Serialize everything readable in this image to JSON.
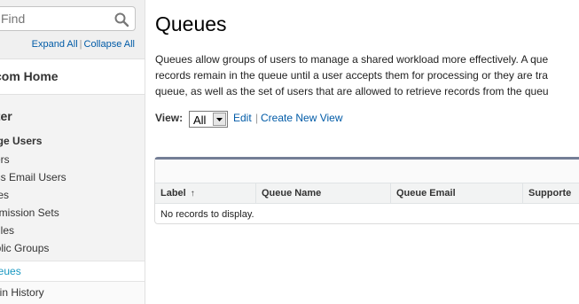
{
  "sidebar": {
    "search_placeholder": "Find",
    "expand_all": "Expand All",
    "separator": "|",
    "collapse_all": "Collapse All",
    "home_link": "com Home",
    "section_title": "ster",
    "group_title": "age Users",
    "items": [
      {
        "label": "sers"
      },
      {
        "label": "ass Email Users"
      },
      {
        "label": "bles"
      },
      {
        "label": "ermission Sets"
      },
      {
        "label": "ofiles"
      },
      {
        "label": "ublic Groups"
      }
    ],
    "selected_item": "ueues",
    "next_item": "gin History"
  },
  "main": {
    "title": "Queues",
    "description_lines": [
      "Queues allow groups of users to manage a shared workload more effectively. A que",
      "records remain in the queue until a user accepts them for processing or they are tra",
      "queue, as well as the set of users that are allowed to retrieve records from the queu"
    ],
    "view_label": "View:",
    "view_selected": "All",
    "edit_link": "Edit",
    "link_separator": "|",
    "create_view_link": "Create New View",
    "table": {
      "columns": [
        "Label",
        "Queue Name",
        "Queue Email",
        "Supporte"
      ],
      "sort_indicator": "↑",
      "empty_message": "No records to display."
    }
  },
  "colors": {
    "link": "#015ba7",
    "selected_nav": "#1797c0",
    "list_header_bar": "#747e96"
  }
}
